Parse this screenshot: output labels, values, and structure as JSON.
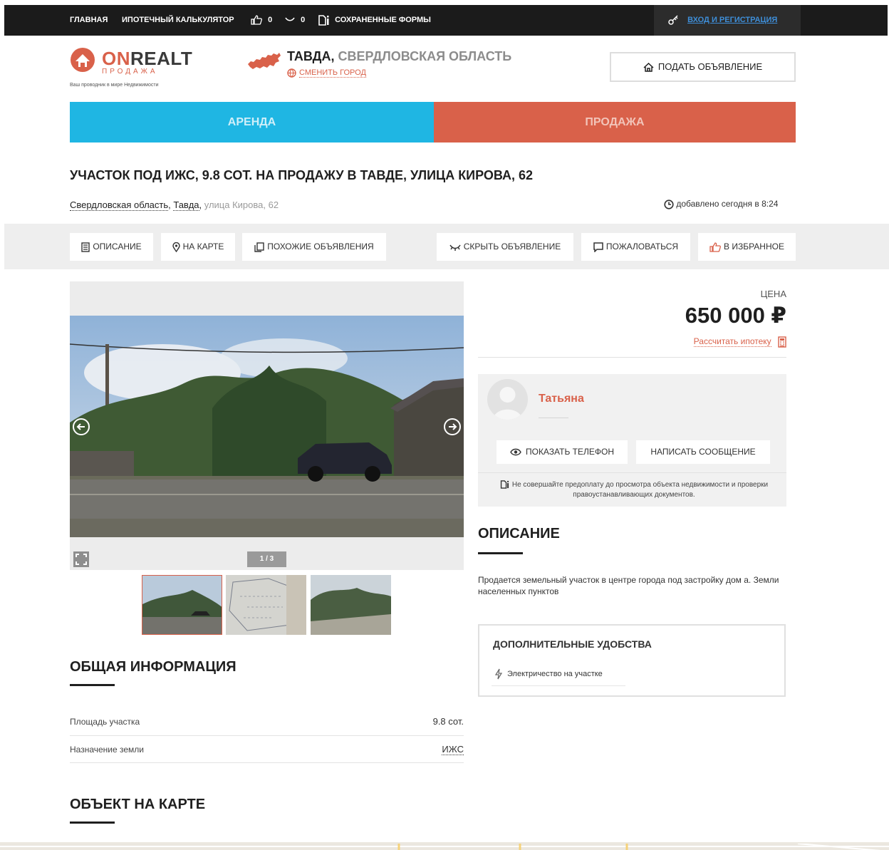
{
  "topbar": {
    "home": "Главная",
    "mortgage_calc": "Ипотечный калькулятор",
    "likes_count": "0",
    "hidden_count": "0",
    "saved_forms": "Сохраненные формы",
    "login": "Вход и регистрация"
  },
  "header": {
    "logo_on": "ON",
    "logo_realt": "REALT",
    "logo_sub": "ПРОДАЖА",
    "logo_tagline": "Ваш проводник в мире Недвижимости",
    "city": "Тавда,",
    "region": " Свердловская область",
    "change_city": "Сменить город",
    "post_button": "Подать объявление"
  },
  "mode_tabs": {
    "rent": "Аренда",
    "sale": "Продажа"
  },
  "listing": {
    "title": "Участок под ИЖС, 9.8 сот. на продажу в Тавде, улица Кирова, 62",
    "address_region": "Свердловская область",
    "address_city": "Тавда",
    "address_street": "улица Кирова, 62",
    "added": "добавлено сегодня в 8:24"
  },
  "actions": {
    "description": "Описание",
    "on_map": "На карте",
    "similar": "Похожие объявления",
    "hide": "Скрыть объявление",
    "report": "Пожаловаться",
    "favorite": "В избранное"
  },
  "gallery": {
    "counter": "1 / 3"
  },
  "price": {
    "label": "Цена",
    "value": "650 000 ₽",
    "mortgage_link": "Рассчитать ипотеку"
  },
  "seller": {
    "name": "Татьяна",
    "show_phone": "Показать телефон",
    "write_message": "Написать сообщение",
    "warning": "Не совершайте предоплату до просмотра объекта недвижимости и проверки правоустанавливающих документов."
  },
  "description": {
    "heading": "Описание",
    "text": "Продается земельный участок в центре города под застройку дом а. Земли населенных пунктов"
  },
  "amenities": {
    "heading": "Дополнительные удобства",
    "items": [
      "Электричество на участке"
    ]
  },
  "general_info": {
    "heading": "Общая информация",
    "rows": [
      {
        "label": "Площадь участка",
        "value": "9.8 сот."
      },
      {
        "label": "Назначение земли",
        "value": "ИЖС"
      }
    ]
  },
  "map_section": {
    "heading": "Объект на карте"
  },
  "colors": {
    "accent": "#d9614a",
    "rent_blue": "#1fb6e3",
    "topbar": "#1b1b1b",
    "link_blue": "#3e8ed8"
  }
}
